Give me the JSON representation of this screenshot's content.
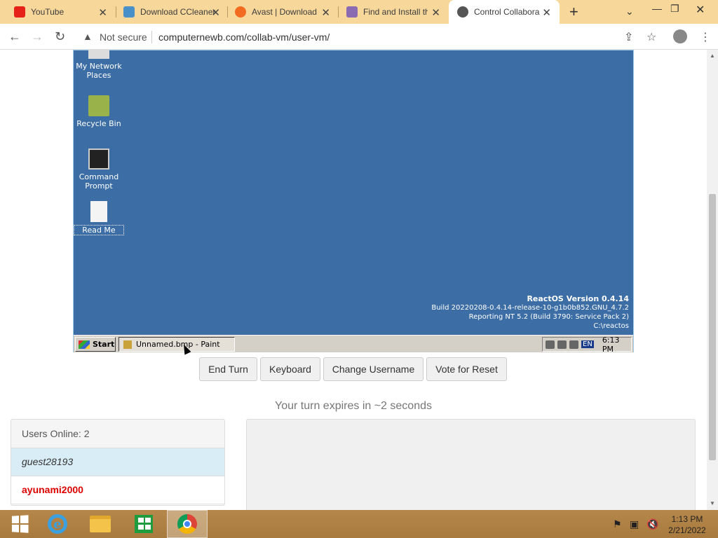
{
  "browser": {
    "tabs": [
      {
        "label": "YouTube",
        "icon": "youtube-icon",
        "active": false
      },
      {
        "label": "Download CCleaner",
        "icon": "ccleaner-icon",
        "active": false
      },
      {
        "label": "Avast | Download",
        "icon": "avast-icon",
        "active": false
      },
      {
        "label": "Find and Install th",
        "icon": "find-install-icon",
        "active": false
      },
      {
        "label": "Control Collabora",
        "icon": "collabvm-icon",
        "active": true
      }
    ],
    "security_label": "Not secure",
    "url": "computernewb.com/collab-vm/user-vm/"
  },
  "vm": {
    "desktop_icons": [
      {
        "label": "My Network Places",
        "icon": "network-places-icon"
      },
      {
        "label": "Recycle Bin",
        "icon": "recycle-bin-icon"
      },
      {
        "label": "Command Prompt",
        "icon": "command-prompt-icon"
      },
      {
        "label": "Read Me",
        "icon": "read-me-icon"
      }
    ],
    "version_info": {
      "title": "ReactOS Version 0.4.14",
      "build": "Build 20220208-0.4.14-release-10-g1b0b852.GNU_4.7.2",
      "reporting": "Reporting NT 5.2 (Build 3790: Service Pack 2)",
      "path": "C:\\reactos"
    },
    "taskbar": {
      "start_label": "Start",
      "task_label": "Unnamed.bmp - Paint",
      "lang": "EN",
      "time": "6:13 PM"
    }
  },
  "controls": {
    "end_turn": "End Turn",
    "keyboard": "Keyboard",
    "change_username": "Change Username",
    "vote_reset": "Vote for Reset"
  },
  "turn_message": "Your turn expires in ~2 seconds",
  "users": {
    "header": "Users Online: 2",
    "list": [
      {
        "name": "guest28193",
        "type": "guest"
      },
      {
        "name": "ayunami2000",
        "type": "admin"
      }
    ]
  },
  "windows_taskbar": {
    "time": "1:13 PM",
    "date": "2/21/2022"
  }
}
